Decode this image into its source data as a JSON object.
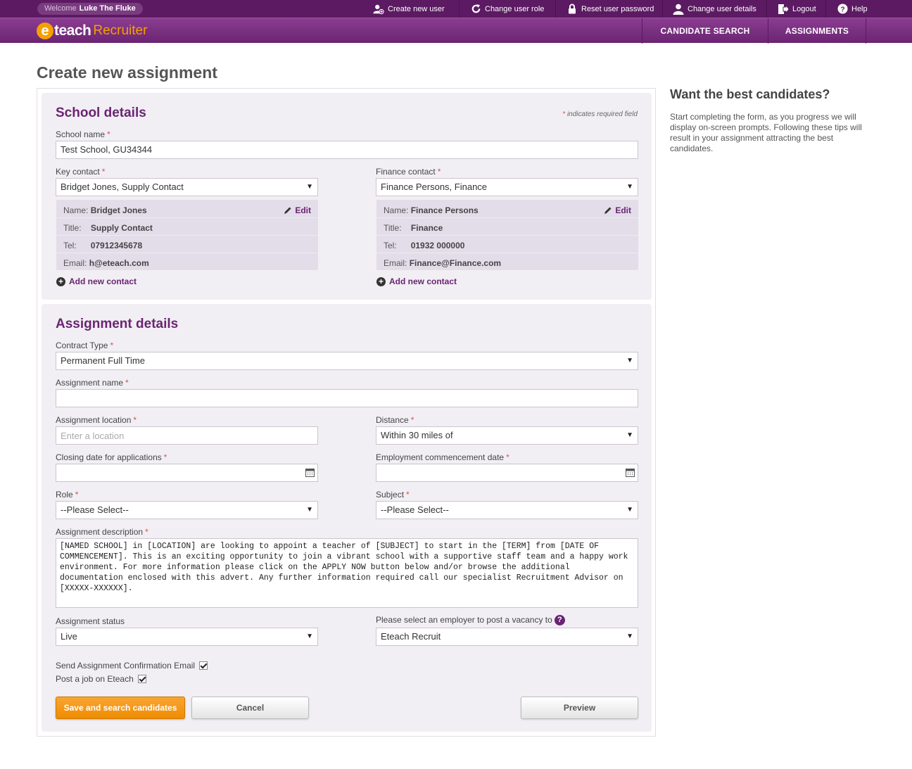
{
  "topbar": {
    "welcome_label": "Welcome",
    "user_name": "Luke The Fluke",
    "links": {
      "create_user": "Create new user",
      "change_role": "Change user role",
      "reset_password": "Reset user password",
      "change_details": "Change user details",
      "logout": "Logout",
      "help": "Help"
    }
  },
  "header": {
    "logo_e": "e",
    "logo_teach": "teach",
    "logo_recruiter": "Recruiter",
    "nav": {
      "candidate_search": "CANDIDATE SEARCH",
      "assignments": "ASSIGNMENTS"
    }
  },
  "page": {
    "title": "Create new assignment"
  },
  "school": {
    "title": "School details",
    "required_note": "indicates required field",
    "school_name_label": "School name",
    "school_name_value": "Test School, GU34344",
    "key_contact": {
      "label": "Key contact",
      "selected": "Bridget Jones, Supply Contact",
      "name_label": "Name:",
      "name": "Bridget Jones",
      "title_label": "Title:",
      "title": "Supply Contact",
      "tel_label": "Tel:",
      "tel": "07912345678",
      "email_label": "Email:",
      "email": "h@eteach.com",
      "edit": "Edit",
      "add_new": "Add new contact"
    },
    "finance_contact": {
      "label": "Finance contact",
      "selected": "Finance Persons, Finance",
      "name_label": "Name:",
      "name": "Finance Persons",
      "title_label": "Title:",
      "title": "Finance",
      "tel_label": "Tel:",
      "tel": "01932 000000",
      "email_label": "Email:",
      "email": "Finance@Finance.com",
      "edit": "Edit",
      "add_new": "Add new contact"
    }
  },
  "assignment": {
    "title": "Assignment details",
    "contract_type_label": "Contract Type",
    "contract_type_value": "Permanent Full Time",
    "name_label": "Assignment name",
    "name_value": "",
    "location_label": "Assignment location",
    "location_placeholder": "Enter a location",
    "distance_label": "Distance",
    "distance_value": "Within 30 miles of",
    "closing_date_label": "Closing date for applications",
    "commencement_label": "Employment commencement date",
    "role_label": "Role",
    "role_value": "--Please Select--",
    "subject_label": "Subject",
    "subject_value": "--Please Select--",
    "description_label": "Assignment description",
    "description_value": "[NAMED SCHOOL] in [LOCATION] are looking to appoint a teacher of [SUBJECT] to start in the [TERM] from [DATE OF COMMENCEMENT]. This is an exciting opportunity to join a vibrant school with a supportive staff team and a happy work environment. For more information please click on the APPLY NOW button below and/or browse the additional documentation enclosed with this advert. Any further information required call our specialist Recruitment Advisor on [XXXXX-XXXXXX].",
    "status_label": "Assignment status",
    "status_value": "Live",
    "employer_label": "Please select an employer to post a vacancy to",
    "employer_value": "Eteach Recruit",
    "send_email_label": "Send Assignment Confirmation Email",
    "post_job_label": "Post a job on Eteach",
    "help_symbol": "?"
  },
  "buttons": {
    "save": "Save and search candidates",
    "cancel": "Cancel",
    "preview": "Preview"
  },
  "sidebar": {
    "title": "Want the best candidates?",
    "text": "Start completing the form, as you progress we will display on-screen prompts. Following these tips will result in your assignment attracting the best candidates."
  },
  "symbols": {
    "required": "*",
    "dropdown": "▼"
  },
  "colors": {
    "brand_purple": "#6b2472",
    "topbar_purple": "#5c1a63",
    "accent_orange": "#f5a000",
    "panel_bg": "#f1eff4",
    "required_red": "#d9534f"
  }
}
